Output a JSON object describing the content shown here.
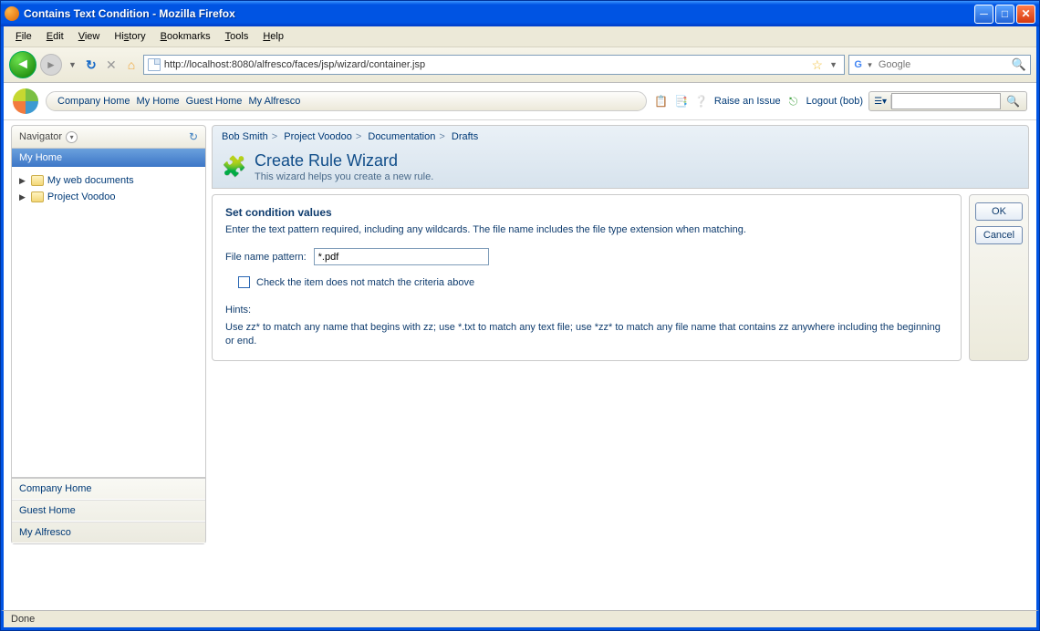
{
  "window": {
    "title": "Contains Text Condition - Mozilla Firefox"
  },
  "menubar": [
    "File",
    "Edit",
    "View",
    "History",
    "Bookmarks",
    "Tools",
    "Help"
  ],
  "toolbar": {
    "url": "http://localhost:8080/alfresco/faces/jsp/wizard/container.jsp",
    "search_placeholder": "Google"
  },
  "app_nav": {
    "links": [
      "Company Home",
      "My Home",
      "Guest Home",
      "My Alfresco"
    ],
    "raise_issue": "Raise an Issue",
    "logout": "Logout (bob)"
  },
  "navigator": {
    "title": "Navigator",
    "current": "My Home",
    "items": [
      {
        "label": "My web documents"
      },
      {
        "label": "Project Voodoo"
      }
    ],
    "quick_links": [
      "Company Home",
      "Guest Home",
      "My Alfresco"
    ]
  },
  "breadcrumb": [
    "Bob Smith",
    "Project Voodoo",
    "Documentation",
    "Drafts"
  ],
  "wizard": {
    "title": "Create Rule Wizard",
    "subtitle": "This wizard helps you create a new rule."
  },
  "form": {
    "section_title": "Set condition values",
    "section_desc": "Enter the text pattern required, including any wildcards. The file name includes the file type extension when matching.",
    "pattern_label": "File name pattern:",
    "pattern_value": "*.pdf",
    "invert_label": "Check the item does not match the criteria above",
    "hints_title": "Hints:",
    "hints_text": "Use zz* to match any name that begins with zz; use *.txt to match any text file; use *zz* to match any file name that contains zz anywhere including the beginning or end."
  },
  "buttons": {
    "ok": "OK",
    "cancel": "Cancel"
  },
  "status": "Done"
}
